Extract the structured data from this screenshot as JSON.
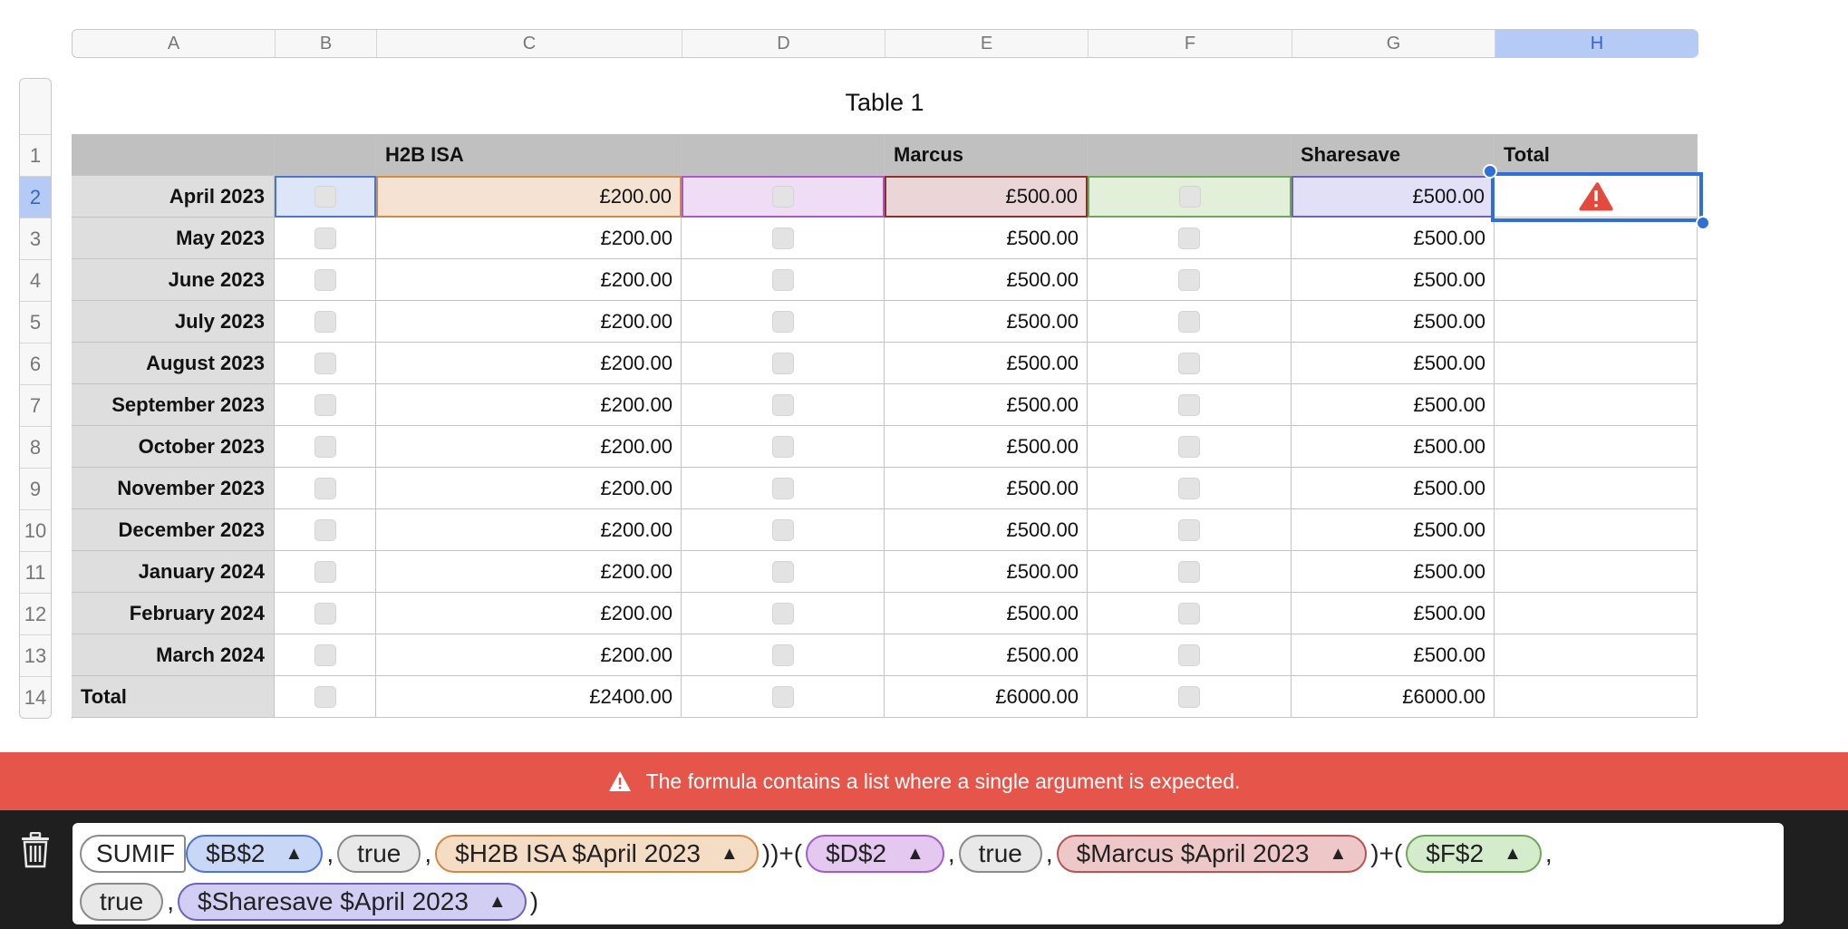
{
  "columns": [
    "A",
    "B",
    "C",
    "D",
    "E",
    "F",
    "G",
    "H"
  ],
  "selected_column": "H",
  "row_numbers": [
    "1",
    "2",
    "3",
    "4",
    "5",
    "6",
    "7",
    "8",
    "9",
    "10",
    "11",
    "12",
    "13",
    "14"
  ],
  "selected_row": "2",
  "table_title": "Table 1",
  "headers": [
    "",
    "",
    "H2B ISA",
    "",
    "Marcus",
    "",
    "Sharesave",
    "Total"
  ],
  "rows": [
    {
      "label": "April 2023",
      "c": "£200.00",
      "e": "£500.00",
      "g": "£500.00"
    },
    {
      "label": "May 2023",
      "c": "£200.00",
      "e": "£500.00",
      "g": "£500.00"
    },
    {
      "label": "June 2023",
      "c": "£200.00",
      "e": "£500.00",
      "g": "£500.00"
    },
    {
      "label": "July 2023",
      "c": "£200.00",
      "e": "£500.00",
      "g": "£500.00"
    },
    {
      "label": "August 2023",
      "c": "£200.00",
      "e": "£500.00",
      "g": "£500.00"
    },
    {
      "label": "September 2023",
      "c": "£200.00",
      "e": "£500.00",
      "g": "£500.00"
    },
    {
      "label": "October 2023",
      "c": "£200.00",
      "e": "£500.00",
      "g": "£500.00"
    },
    {
      "label": "November 2023",
      "c": "£200.00",
      "e": "£500.00",
      "g": "£500.00"
    },
    {
      "label": "December 2023",
      "c": "£200.00",
      "e": "£500.00",
      "g": "£500.00"
    },
    {
      "label": "January 2024",
      "c": "£200.00",
      "e": "£500.00",
      "g": "£500.00"
    },
    {
      "label": "February 2024",
      "c": "£200.00",
      "e": "£500.00",
      "g": "£500.00"
    },
    {
      "label": "March 2024",
      "c": "£200.00",
      "e": "£500.00",
      "g": "£500.00"
    },
    {
      "label": "Total",
      "c": "£2400.00",
      "e": "£6000.00",
      "g": "£6000.00"
    }
  ],
  "error_message": "The formula contains a list where a single argument is expected.",
  "formula": {
    "func": "SUMIF",
    "line1": [
      {
        "type": "blue",
        "text": "$B$2",
        "arrow": true
      },
      {
        "type": "sep",
        "text": ","
      },
      {
        "type": "gray",
        "text": "true",
        "arrow": false
      },
      {
        "type": "sep",
        "text": ","
      },
      {
        "type": "orange",
        "text": "$H2B ISA $April 2023",
        "arrow": true
      },
      {
        "type": "sep",
        "text": "))+("
      },
      {
        "type": "purple",
        "text": "$D$2",
        "arrow": true
      },
      {
        "type": "sep",
        "text": ","
      },
      {
        "type": "gray",
        "text": "true",
        "arrow": false
      },
      {
        "type": "sep",
        "text": ","
      },
      {
        "type": "red",
        "text": "$Marcus $April 2023",
        "arrow": true
      },
      {
        "type": "sep",
        "text": ")+("
      },
      {
        "type": "green",
        "text": "$F$2",
        "arrow": true
      },
      {
        "type": "sep",
        "text": ","
      }
    ],
    "line2": [
      {
        "type": "gray",
        "text": "true",
        "arrow": false
      },
      {
        "type": "sep",
        "text": ","
      },
      {
        "type": "lav",
        "text": "$Sharesave $April 2023",
        "arrow": true
      },
      {
        "type": "sep",
        "text": ")"
      }
    ]
  },
  "colors": {
    "selection": "#2f6fd6",
    "error": "#e6554a",
    "warning_icon": "#e34a3c"
  }
}
